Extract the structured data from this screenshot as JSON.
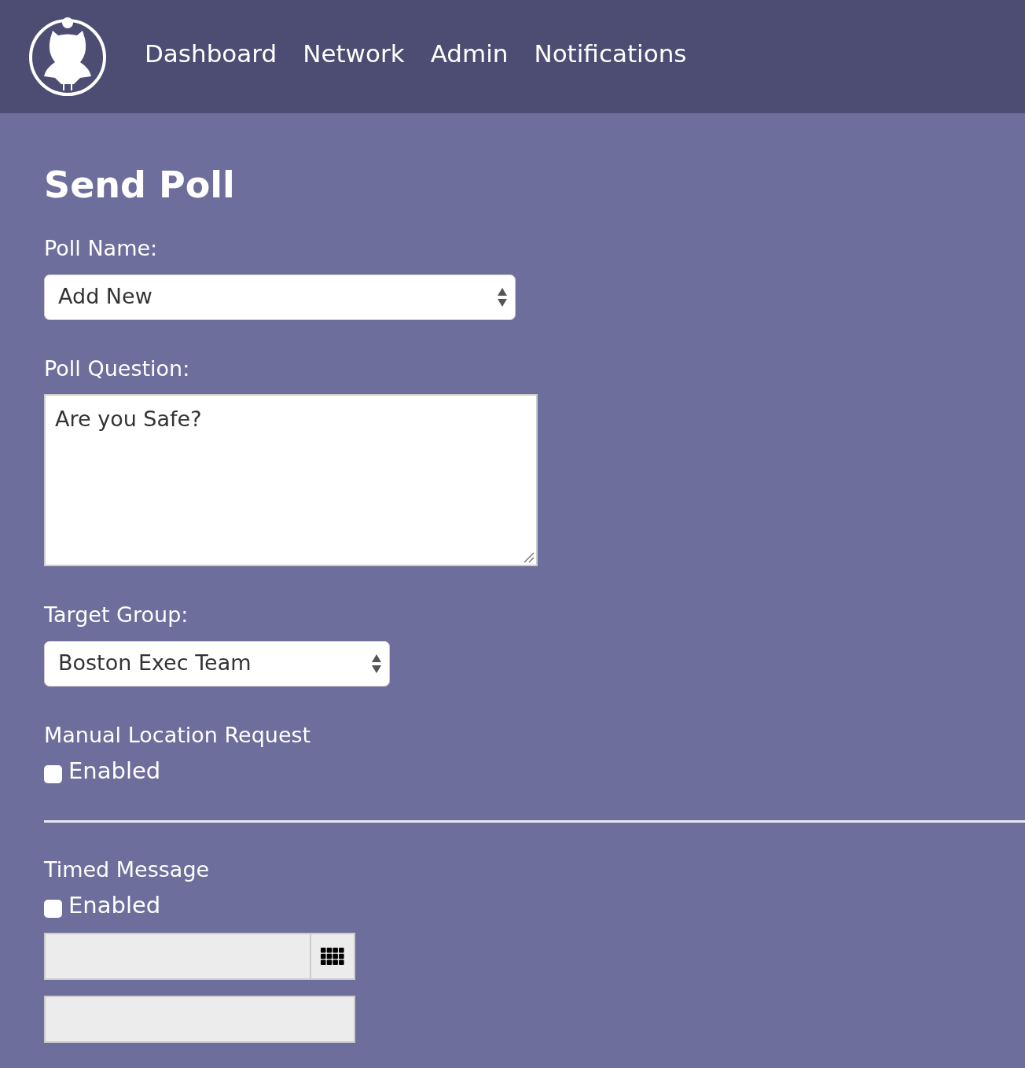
{
  "nav": {
    "items": [
      {
        "label": "Dashboard"
      },
      {
        "label": "Network"
      },
      {
        "label": "Admin"
      },
      {
        "label": "Notifications"
      }
    ]
  },
  "title": "Send Poll",
  "poll_name": {
    "label": "Poll Name:",
    "value": "Add New"
  },
  "poll_question": {
    "label": "Poll Question:",
    "value": "Are you Safe?"
  },
  "target_group": {
    "label": "Target Group:",
    "value": "Boston Exec Team"
  },
  "manual_location": {
    "label": "Manual Location Request",
    "checkbox": {
      "label": "Enabled",
      "checked": false
    }
  },
  "timed_message": {
    "label": "Timed Message",
    "checkbox": {
      "label": "Enabled",
      "checked": false
    }
  }
}
